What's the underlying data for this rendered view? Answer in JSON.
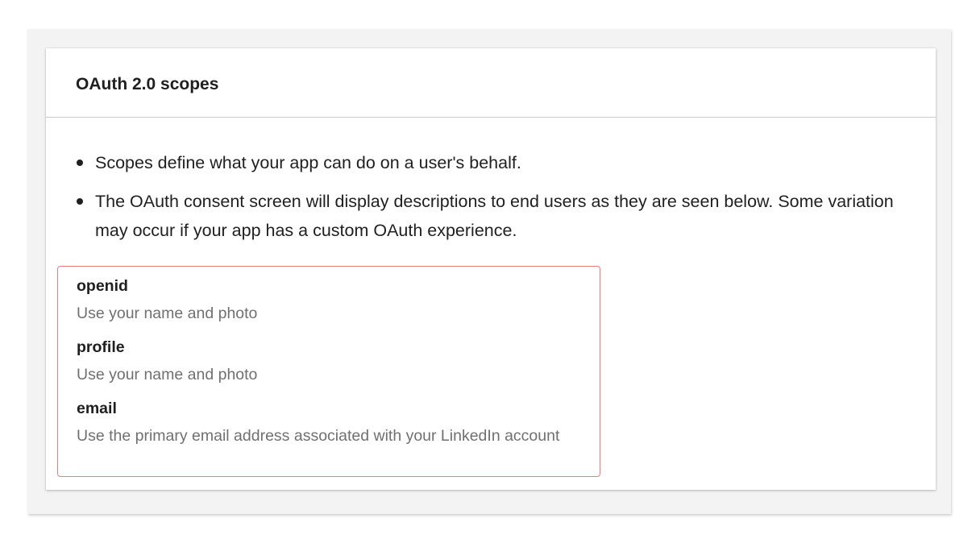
{
  "panel": {
    "title": "OAuth 2.0 scopes",
    "bullets": [
      "Scopes define what your app can do on a user's behalf.",
      "The OAuth consent screen will display descriptions to end users as they are seen below. Some variation may occur if your app has a custom OAuth experience."
    ],
    "scopes": [
      {
        "name": "openid",
        "description": "Use your name and photo"
      },
      {
        "name": "profile",
        "description": "Use your name and photo"
      },
      {
        "name": "email",
        "description": "Use the primary email address associated with your LinkedIn account"
      }
    ]
  },
  "colors": {
    "highlight_border": "#f07a7a",
    "description_text": "#707070",
    "divider": "#c8c8c8"
  }
}
